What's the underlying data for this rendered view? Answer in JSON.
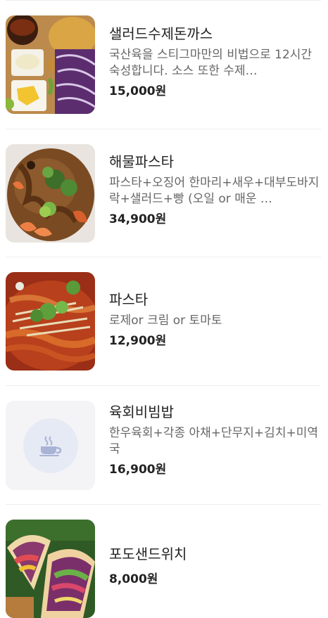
{
  "menu": {
    "items": [
      {
        "name": "샐러드수제돈까스",
        "description": "국산육을 스티그마만의 비법으로 12시간 숙성합니다. 소스 또한 수제…",
        "price": "15,000원",
        "image": "food-photo-tonkatsu"
      },
      {
        "name": "해물파스타",
        "description": "파스타+오징어 한마리+새우+대부도바지락+샐러드+빵 (오일 or 매운 …",
        "price": "34,900원",
        "image": "food-photo-seafood-pasta"
      },
      {
        "name": "파스타",
        "description": "로제or 크림 or 토마토",
        "price": "12,900원",
        "image": "food-photo-pasta"
      },
      {
        "name": "육회비빔밥",
        "description": "한우육회+각종 아채+단무지+김치+미역국",
        "price": "16,900원",
        "image": "coffee-cup-icon"
      },
      {
        "name": "포도샌드위치",
        "description": "",
        "price": "8,000원",
        "image": "food-photo-sandwich"
      }
    ]
  }
}
